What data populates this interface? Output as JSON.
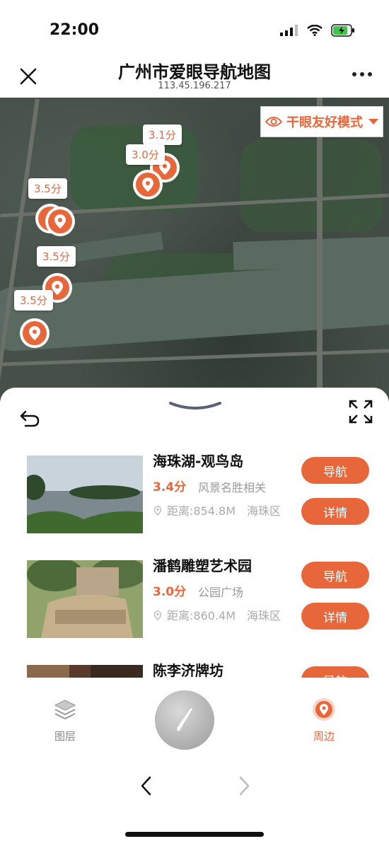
{
  "status": {
    "time": "22:00",
    "icons": [
      "signal-icon",
      "wifi-icon",
      "battery-charging-icon"
    ]
  },
  "nav": {
    "title": "广州市爱眼导航地图",
    "subtitle": "113.45.196.217",
    "close_icon": "close-icon",
    "more_icon": "more-icon"
  },
  "map": {
    "mode_label": "干眼友好模式",
    "markers": [
      {
        "rating": "3.1分"
      },
      {
        "rating": "3.0分"
      },
      {
        "rating": "3.5分"
      },
      {
        "rating": "3.5分"
      },
      {
        "rating": "3.5分"
      }
    ]
  },
  "sheet": {
    "items": [
      {
        "name": "海珠湖-观鸟岛",
        "score": "3.4分",
        "category": "风景名胜相关",
        "distance": "距离:854.8M　海珠区",
        "nav_label": "导航",
        "detail_label": "详情"
      },
      {
        "name": "潘鹤雕塑艺术园",
        "score": "3.0分",
        "category": "公园广场",
        "distance": "距离:860.4M　海珠区",
        "nav_label": "导航",
        "detail_label": "详情"
      },
      {
        "name": "陈李济牌坊",
        "nav_label": "导航"
      }
    ]
  },
  "tabbar": {
    "layers_label": "图层",
    "nearby_label": "周边"
  },
  "colors": {
    "accent": "#e8673a",
    "muted": "#999999"
  }
}
